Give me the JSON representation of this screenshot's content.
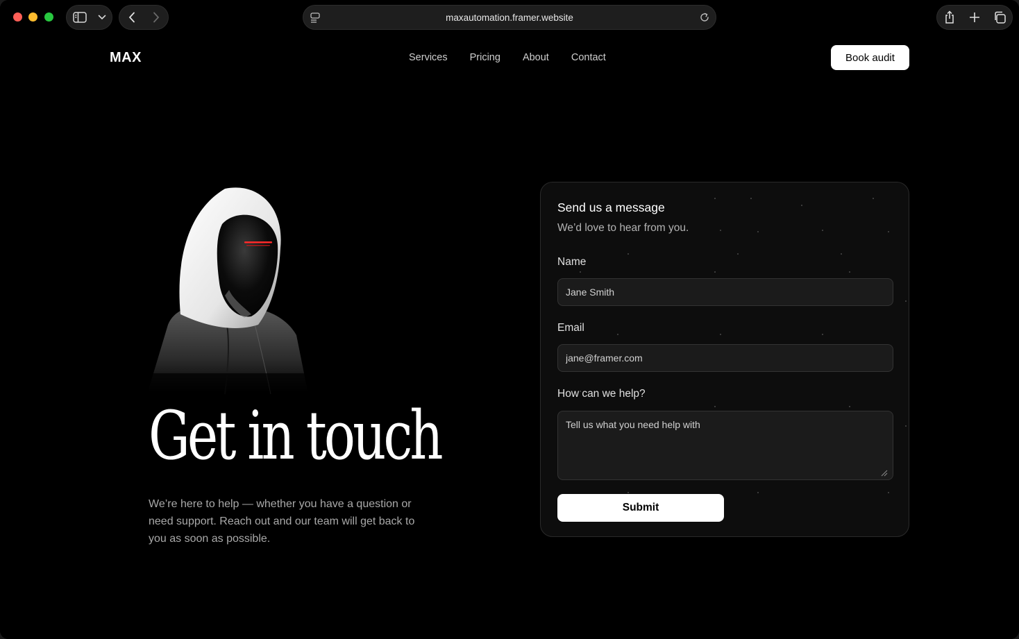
{
  "browser": {
    "url": "maxautomation.framer.website",
    "icons": [
      "sidebar-icon",
      "chevron-down-icon",
      "back-icon",
      "forward-icon",
      "page-settings-icon",
      "reload-icon",
      "share-icon",
      "new-tab-icon",
      "tabs-overview-icon"
    ]
  },
  "header": {
    "logo": "MAX",
    "nav": [
      "Services",
      "Pricing",
      "About",
      "Contact"
    ],
    "cta": "Book audit"
  },
  "hero": {
    "headline": "Get in touch",
    "description": "We’re here to help — whether you have a question or need support. Reach out and our team will get back to you as soon as possible."
  },
  "form": {
    "title": "Send us a message",
    "subtitle": "We’d love to hear from you.",
    "name_label": "Name",
    "name_placeholder": "Jane Smith",
    "email_label": "Email",
    "email_placeholder": "jane@framer.com",
    "message_label": "How can we help?",
    "message_placeholder": "Tell us what you need help with",
    "submit": "Submit"
  },
  "colors": {
    "background": "#000000",
    "card": "#0d0d0d",
    "field": "#1b1b1b",
    "accent_red": "#ff2a2a"
  }
}
